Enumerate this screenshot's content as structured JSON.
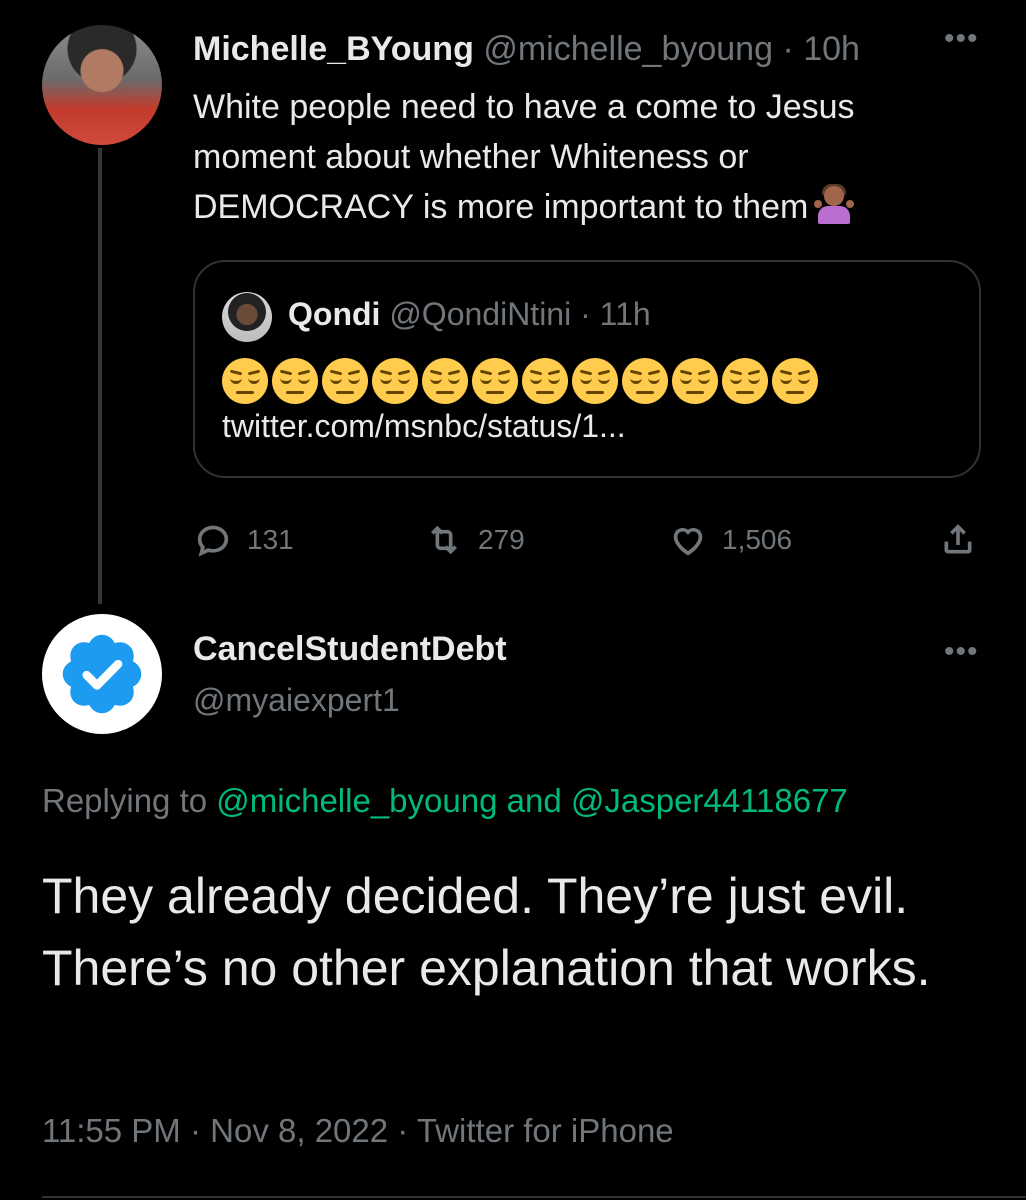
{
  "parent_tweet": {
    "display_name": "Michelle_BYoung",
    "handle": "@michelle_byoung",
    "separator": "·",
    "time": "10h",
    "more_icon": "more-horizontal-icon",
    "text": "White people need to have a come to Jesus moment about whether Whiteness or DEMOCRACY is more important to them",
    "emoji": "person-shrugging-emoji",
    "quote": {
      "display_name": "Qondi",
      "handle": "@QondiNtini",
      "separator": "·",
      "time": "11h",
      "emoji_count": 12,
      "emoji": "unamused-face-emoji",
      "link": "twitter.com/msnbc/status/1..."
    },
    "actions": {
      "replies": "131",
      "retweets": "279",
      "likes": "1,506"
    }
  },
  "reply_tweet": {
    "display_name": "CancelStudentDebt",
    "handle": "@myaiexpert1",
    "avatar_icon": "verified-badge-icon",
    "more_icon": "more-horizontal-icon",
    "replying_prefix": "Replying to",
    "replying_user1": "@michelle_byoung",
    "replying_and": "and",
    "replying_user2": "@Jasper44118677",
    "text": "They already decided. They’re just evil. There’s no other explanation that works.",
    "time": "11:55 PM",
    "date": "Nov 8, 2022",
    "client": "Twitter for iPhone",
    "meta_sep": "·"
  },
  "colors": {
    "background": "#000000",
    "text": "#e7e9ea",
    "muted": "#71767b",
    "mention": "#00ba7c",
    "verified": "#1d9bf0"
  }
}
